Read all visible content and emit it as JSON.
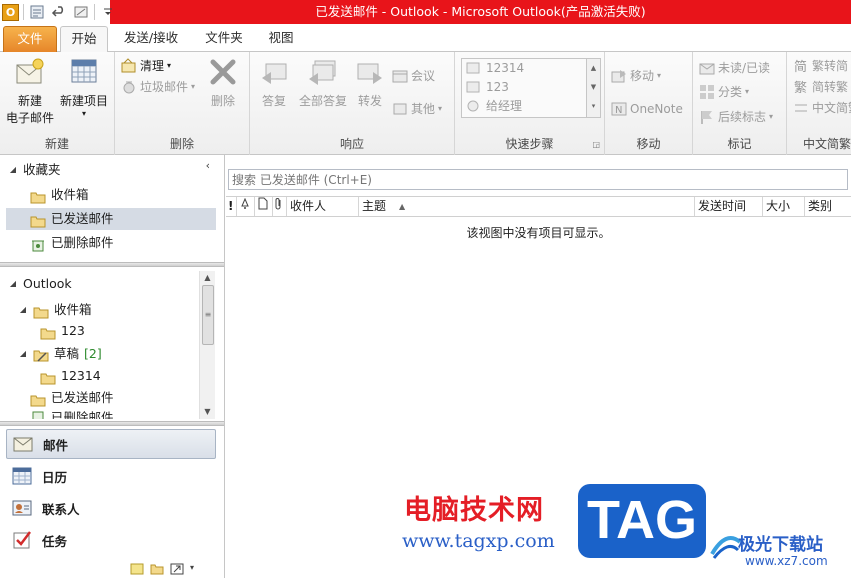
{
  "titlebar": {
    "title": "已发送邮件 - Outlook - Microsoft Outlook(产品激活失败)",
    "app_icon": "O"
  },
  "ribbon_tabs": [
    "文件",
    "开始",
    "发送/接收",
    "文件夹",
    "视图"
  ],
  "ribbon": {
    "new": {
      "new_email_line1": "新建",
      "new_email_line2": "电子邮件",
      "new_items": "新建项目",
      "group": "新建"
    },
    "delete": {
      "cleanup": "清理",
      "junk": "垃圾邮件",
      "delete": "删除",
      "group": "删除"
    },
    "respond": {
      "reply": "答复",
      "reply_all": "全部答复",
      "forward": "转发",
      "meeting": "会议",
      "more": "其他",
      "group": "响应"
    },
    "quicksteps": {
      "items": [
        "12314",
        "123",
        "给经理"
      ],
      "group": "快速步骤"
    },
    "move": {
      "move": "移动",
      "onenote": "OneNote",
      "group": "移动"
    },
    "tags": {
      "unread": "未读/已读",
      "categorize": "分类",
      "followup": "后续标志",
      "group": "标记"
    },
    "chinese": {
      "to_simplified": "繁转简",
      "to_traditional": "简转繁",
      "conversion": "中文简繁",
      "group": "中文简繁"
    }
  },
  "favorites": {
    "header": "收藏夹",
    "items": [
      "收件箱",
      "已发送邮件",
      "已删除邮件"
    ]
  },
  "tree": {
    "root": "Outlook",
    "inbox": "收件箱",
    "inbox_sub": "123",
    "drafts": "草稿",
    "drafts_count": "[2]",
    "drafts_sub": "12314",
    "sent": "已发送邮件",
    "deleted": "已删除邮件"
  },
  "nav_buttons": [
    "邮件",
    "日历",
    "联系人",
    "任务"
  ],
  "search": {
    "placeholder": "搜索 已发送邮件 (Ctrl+E)"
  },
  "columns": {
    "importance": "!",
    "reminder": "",
    "type": "",
    "attachment": "",
    "to": "收件人",
    "subject": "主题",
    "sent": "发送时间",
    "size": "大小",
    "category": "类别"
  },
  "empty_message": "该视图中没有项目可显示。",
  "watermark": {
    "cn": "电脑技术网",
    "url": "www.tagxp.com",
    "tag": "TAG",
    "site_name": "极光下载站",
    "site_url": "www.xz7.com"
  },
  "colors": {
    "titlebar": "#e8141a",
    "file_tab": "#e6862a",
    "selection": "#d5dbe4",
    "watermark_red": "#e41e26",
    "watermark_blue": "#1a62c9"
  }
}
